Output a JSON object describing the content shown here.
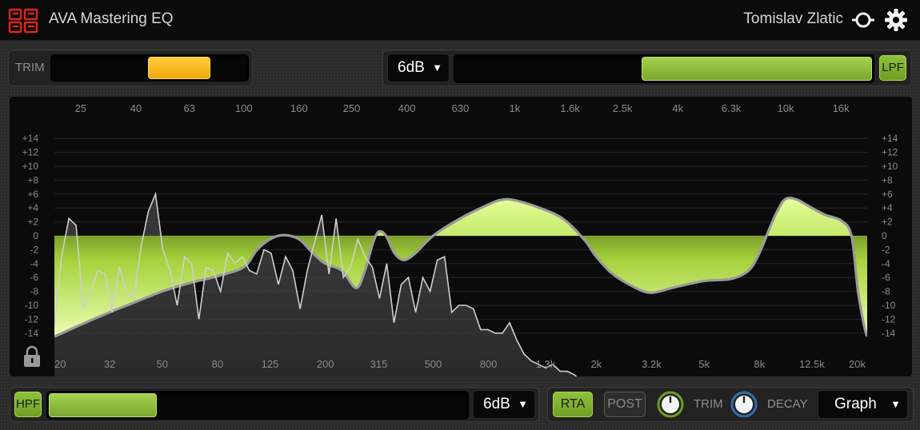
{
  "header": {
    "title": "AVA Mastering EQ",
    "user": "Tomislav Zlatic"
  },
  "trim": {
    "label": "TRIM",
    "value_fraction_start": 0.49,
    "value_fraction_end": 0.81
  },
  "lpf": {
    "slope": "6dB",
    "label": "LPF",
    "fill_start_fraction": 0.446
  },
  "hpf": {
    "label": "HPF",
    "slope": "6dB",
    "fill_end_fraction": 0.257
  },
  "rta": {
    "rta_label": "RTA",
    "post_label": "POST",
    "trim_label": "TRIM",
    "decay_label": "DECAY",
    "view": "Graph"
  },
  "graph": {
    "top_freqs": [
      "25",
      "40",
      "63",
      "100",
      "160",
      "250",
      "400",
      "630",
      "1k",
      "1.6k",
      "2.5k",
      "4k",
      "6.3k",
      "10k",
      "16k"
    ],
    "bottom_freqs": [
      "20",
      "32",
      "50",
      "80",
      "125",
      "200",
      "315",
      "500",
      "800",
      "1.3k",
      "2k",
      "3.2k",
      "5k",
      "8k",
      "12.5k",
      "20k"
    ],
    "db_labels": [
      "+14",
      "+12",
      "+10",
      "+8",
      "+6",
      "+4",
      "+2",
      "0",
      "-2",
      "-4",
      "-6",
      "-8",
      "-10",
      "-12",
      "-14"
    ]
  },
  "colors": {
    "accent_green": "#9ccc48",
    "trim_yellow": "#f9bb25",
    "logo_red": "#d8261c"
  },
  "icons": {
    "logo": "ava-logo-icon",
    "user": "user-icon",
    "settings": "gear-icon",
    "lock": "lock-icon"
  }
}
